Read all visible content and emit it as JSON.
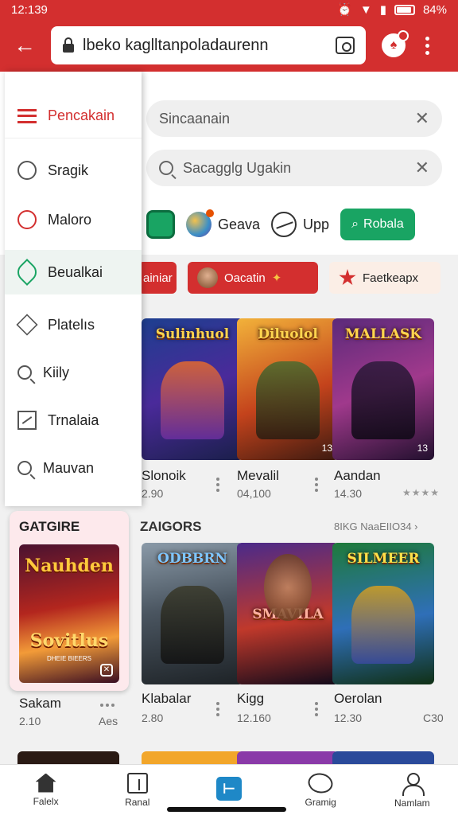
{
  "status": {
    "time": "12:139",
    "battery": "84%"
  },
  "topbar": {
    "url": "lbeko kaglltanpoladaurenn"
  },
  "search": {
    "first": "Sincaanain",
    "second": "Sacagglg Ugakin"
  },
  "chips": {
    "geava": "Geava",
    "upp": "Upp",
    "robala": "Robala"
  },
  "categories": {
    "first": "ainiar",
    "second": "Oacatin",
    "third": "Faetkeapx"
  },
  "drawer": {
    "header": "Pencakain",
    "items": [
      {
        "label": "Sragik",
        "icon": "target-icon"
      },
      {
        "label": "Maloro",
        "icon": "circle-icon"
      },
      {
        "label": "Beualkai",
        "icon": "leaf-icon"
      },
      {
        "label": "Platelıs",
        "icon": "diamond-icon"
      },
      {
        "label": "Kiily",
        "icon": "search-icon"
      },
      {
        "label": "Trnalaia",
        "icon": "chart-icon"
      },
      {
        "label": "Mauvan",
        "icon": "search-icon"
      }
    ],
    "featured": {
      "heading": "GATGIRE",
      "art_title_top": "Nauhden",
      "art_title_bottom": "Sovitlus",
      "art_subtitle": "DHEIE BIEERS",
      "name": "Sakam",
      "meta": "2.10",
      "extra": "Aes"
    }
  },
  "row1": [
    {
      "art": "Sulinhuol",
      "name": "Slonoik",
      "meta": "2.90",
      "badge": ""
    },
    {
      "art": "Diluolol",
      "name": "Mevalil",
      "meta": "04,100",
      "badge": "13"
    },
    {
      "art": "MALLASK",
      "name": "Aandan",
      "meta": "14.30",
      "badge": "13",
      "stars": "★★★★"
    }
  ],
  "section": {
    "heading": "ZAIGORS",
    "link": "8IKG NaaEIIO34 ›"
  },
  "row2": [
    {
      "art": "ODBBRN",
      "name": "Klabalar",
      "meta": "2.80"
    },
    {
      "art": "SMAVILA",
      "name": "Kigg",
      "meta": "12.160"
    },
    {
      "art": "SILMEER",
      "name": "Oerolan",
      "meta": "12.30",
      "extra": "C30"
    }
  ],
  "bottomnav": [
    {
      "label": "Falelx"
    },
    {
      "label": "Ranal"
    },
    {
      "label": ""
    },
    {
      "label": "Gramig"
    },
    {
      "label": "Namlam"
    }
  ],
  "colors": {
    "brand": "#d32f2f",
    "accent_green": "#19a463",
    "nav_active": "#1e88c7"
  }
}
